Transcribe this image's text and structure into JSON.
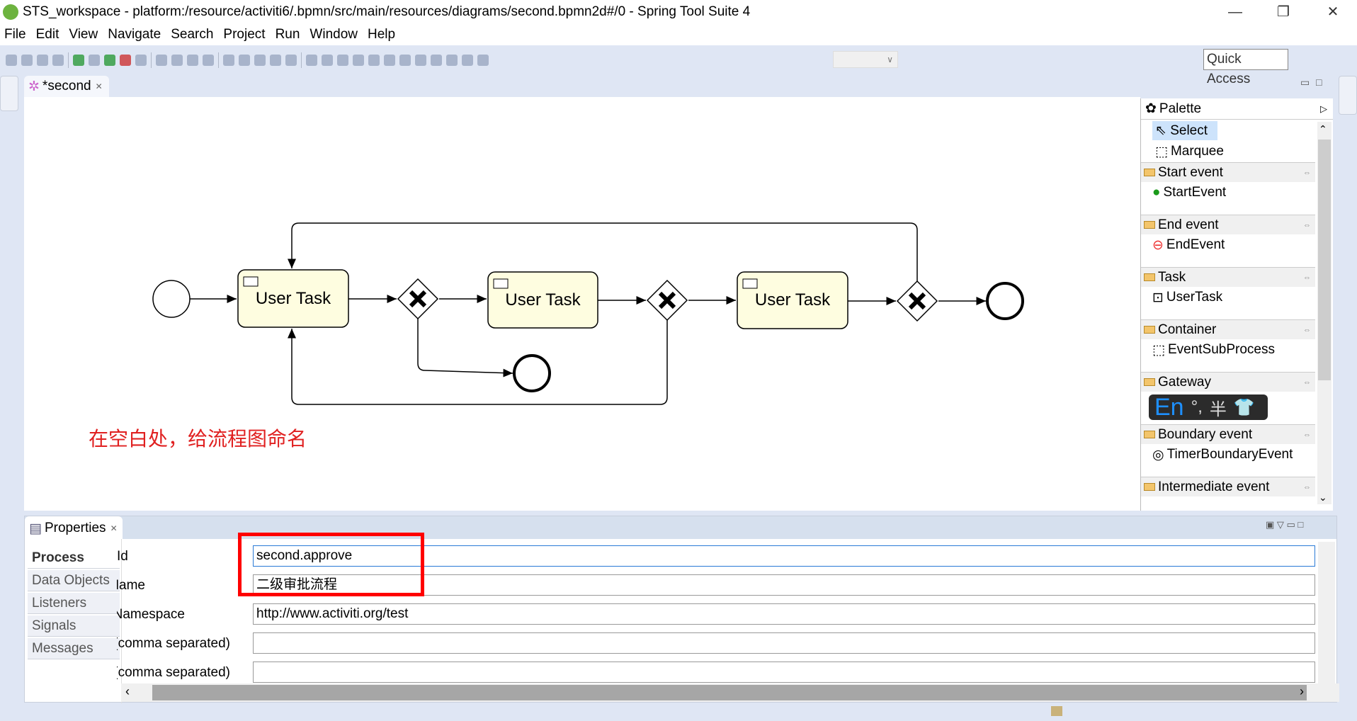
{
  "window": {
    "title": "STS_workspace - platform:/resource/activiti6/.bpmn/src/main/resources/diagrams/second.bpmn2d#/0 - Spring Tool Suite 4",
    "min": "—",
    "restore": "❐",
    "close": "✕"
  },
  "menu": [
    "File",
    "Edit",
    "View",
    "Navigate",
    "Search",
    "Project",
    "Run",
    "Window",
    "Help"
  ],
  "toolbar": {
    "quick_access": "Quick Access",
    "zoom_value": ""
  },
  "editor": {
    "tab_label": "*second",
    "close": "✕"
  },
  "diagram": {
    "tasks": [
      {
        "label": "User Task"
      },
      {
        "label": "User Task"
      },
      {
        "label": "User Task"
      }
    ],
    "gateways": [
      "exclusive",
      "exclusive",
      "exclusive"
    ],
    "annotation": "在空白处，给流程图命名"
  },
  "palette": {
    "title": "Palette",
    "tools": [
      "Select",
      "Marquee"
    ],
    "sections": [
      {
        "label": "Start event",
        "items": [
          "StartEvent"
        ]
      },
      {
        "label": "End event",
        "items": [
          "EndEvent"
        ]
      },
      {
        "label": "Task",
        "items": [
          "UserTask"
        ]
      },
      {
        "label": "Container",
        "items": [
          "EventSubProcess"
        ]
      },
      {
        "label": "Gateway",
        "items": []
      },
      {
        "label": "Boundary event",
        "items": [
          "TimerBoundaryEvent"
        ]
      },
      {
        "label": "Intermediate event",
        "items": []
      }
    ]
  },
  "ime": {
    "lang": "En",
    "punct": "°,",
    "width": "半",
    "skin": "shirt-icon"
  },
  "properties": {
    "tab_label": "Properties",
    "tabs": [
      "Process",
      "Data Objects",
      "Listeners",
      "Signals",
      "Messages"
    ],
    "fields": [
      {
        "label": "Id",
        "value": "second.approve"
      },
      {
        "label": "Name",
        "value": "二级审批流程"
      },
      {
        "label": "Namespace",
        "value": "http://www.activiti.org/test"
      },
      {
        "label": "Candidate start users (comma separated)",
        "value": ""
      },
      {
        "label": "Candidate start groups (comma separated)",
        "value": ""
      }
    ]
  },
  "colors": {
    "task_fill": "#fefde0",
    "highlight": "#ff0000",
    "annotation": "#e02020"
  }
}
